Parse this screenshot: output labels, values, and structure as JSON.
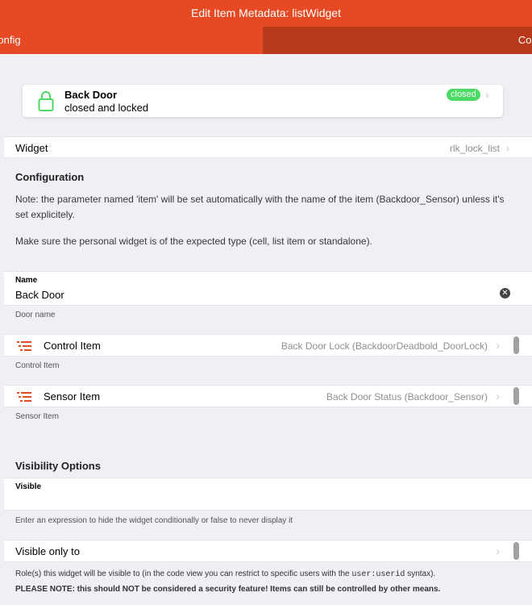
{
  "title": "Edit Item Metadata: listWidget",
  "tabs": {
    "config": "Config",
    "code": "Code"
  },
  "card": {
    "title": "Back Door",
    "subtitle": "closed and locked",
    "badge": "closed",
    "lock_color": "#4cd964",
    "badge_color": "#4cd964"
  },
  "widget_row": {
    "label": "Widget",
    "value": "rlk_lock_list"
  },
  "configuration": {
    "title": "Configuration",
    "note1": "Note: the parameter named 'item' will be set automatically with the name of the item (Backdoor_Sensor) unless it's set explicitely.",
    "note2": "Make sure the personal widget is of the expected type (cell, list item or standalone)."
  },
  "name_field": {
    "label": "Name",
    "value": "Back Door",
    "help": "Door name"
  },
  "control_item": {
    "label": "Control Item",
    "value": "Back Door Lock (BackdoorDeadbold_DoorLock)",
    "help": "Control Item"
  },
  "sensor_item": {
    "label": "Sensor Item",
    "value": "Back Door Status (Backdoor_Sensor)",
    "help": "Sensor Item"
  },
  "visibility": {
    "title": "Visibility Options",
    "visible_label": "Visible",
    "visible_value": "",
    "visible_help": "Enter an expression to hide the widget conditionally or false to never display it",
    "visible_to_label": "Visible only to",
    "role_note_pre": "Role(s) this widget will be visible to (in the code view you can restrict to specific users with the ",
    "role_note_code": "user:userid",
    "role_note_post": " syntax).",
    "warning": "PLEASE NOTE: this should NOT be considered a security feature! Items can still be controlled by other means."
  },
  "colors": {
    "accent": "#e64a24",
    "accent_dark": "#b8391b",
    "list_icon": "#e64a24"
  }
}
